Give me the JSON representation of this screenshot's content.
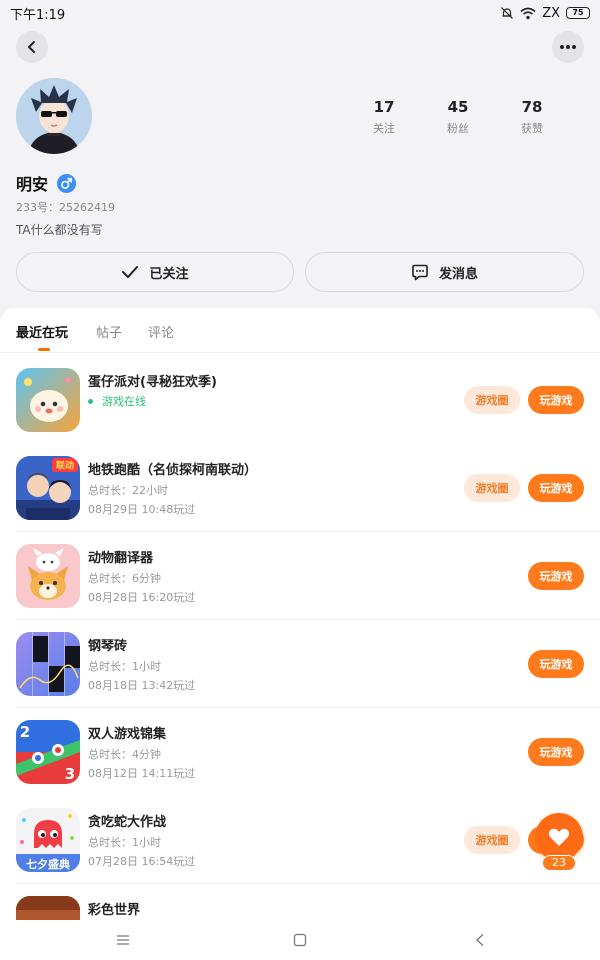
{
  "status_bar": {
    "time": "下午1:19",
    "carrier": "ZX",
    "battery": "75"
  },
  "profile": {
    "name": "明安",
    "uid": "233号：25262419",
    "bio": "TA什么都没有写",
    "stats": [
      {
        "value": "17",
        "label": "关注"
      },
      {
        "value": "45",
        "label": "粉丝"
      },
      {
        "value": "78",
        "label": "获赞"
      }
    ],
    "follow_label": "已关注",
    "message_label": "发消息"
  },
  "tabs": [
    "最近在玩",
    "帖子",
    "评论"
  ],
  "games": [
    {
      "title": "蛋仔派对(寻秘狂欢季)",
      "online": "游戏在线",
      "circle": "游戏圈",
      "play": "玩游戏"
    },
    {
      "title": "地铁跑酷（名侦探柯南联动）",
      "duration": "总时长：22小时",
      "last_played": "08月29日 10:48玩过",
      "circle": "游戏圈",
      "play": "玩游戏",
      "badge": "联动"
    },
    {
      "title": "动物翻译器",
      "duration": "总时长：6分钟",
      "last_played": "08月28日 16:20玩过",
      "play": "玩游戏"
    },
    {
      "title": "钢琴砖",
      "duration": "总时长：1小时",
      "last_played": "08月18日 13:42玩过",
      "play": "玩游戏"
    },
    {
      "title": "双人游戏锦集",
      "duration": "总时长：4分钟",
      "last_played": "08月12日 14:11玩过",
      "play": "玩游戏",
      "icon_numbers": [
        "2",
        "3"
      ]
    },
    {
      "title": "贪吃蛇大作战",
      "duration": "总时长：1小时",
      "last_played": "07月28日 16:54玩过",
      "circle": "游戏圈",
      "play": "玩游戏",
      "badge": "七夕盛典"
    },
    {
      "title": "彩色世界"
    }
  ],
  "like_count": "23",
  "colors": {
    "accent": "#ff7a1a",
    "online": "#2ec27e",
    "gender": "#3a8ff5"
  }
}
